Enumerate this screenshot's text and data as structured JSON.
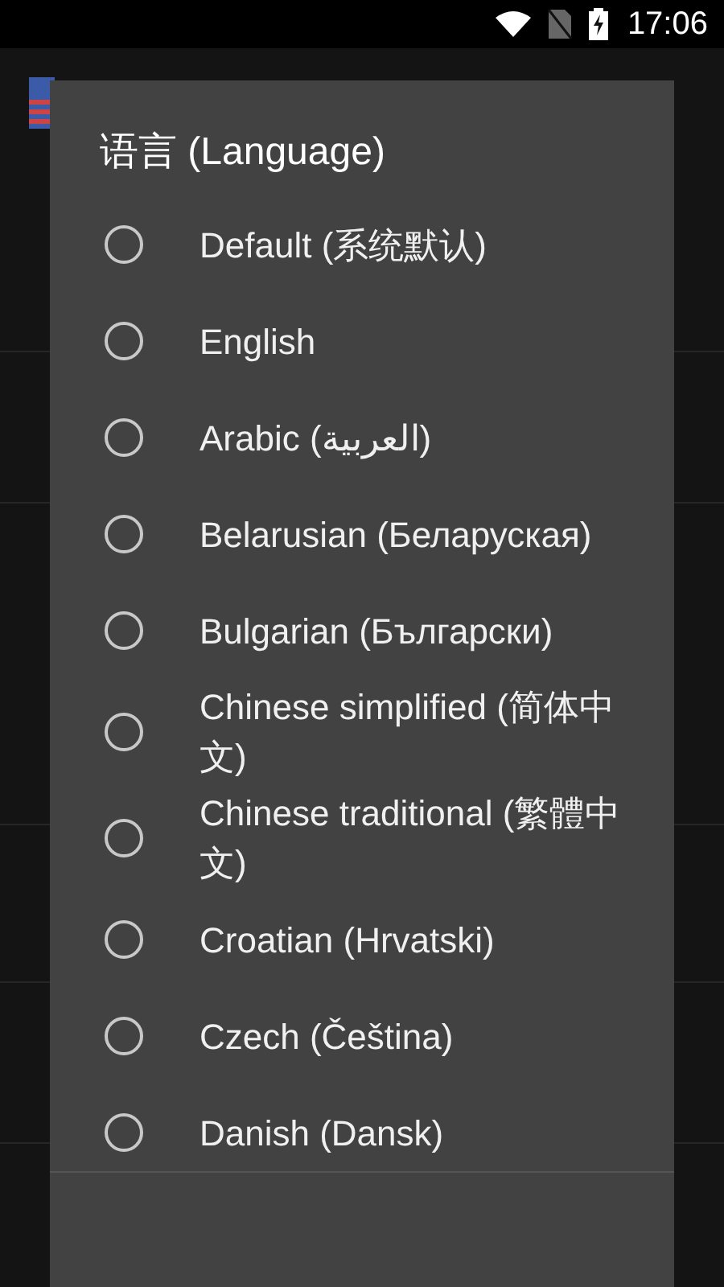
{
  "status_bar": {
    "time": "17:06"
  },
  "dialog": {
    "title": "语言 (Language)",
    "options": [
      {
        "label": "Default (系统默认)",
        "selected": false
      },
      {
        "label": "English",
        "selected": false
      },
      {
        "label": "Arabic (العربية)",
        "selected": false
      },
      {
        "label": "Belarusian (Беларуская)",
        "selected": false
      },
      {
        "label": "Bulgarian (Български)",
        "selected": false
      },
      {
        "label": "Chinese simplified (简体中文)",
        "selected": false
      },
      {
        "label": "Chinese traditional (繁體中文)",
        "selected": false
      },
      {
        "label": "Croatian (Hrvatski)",
        "selected": false
      },
      {
        "label": "Czech (Čeština)",
        "selected": false
      },
      {
        "label": "Danish (Dansk)",
        "selected": false
      }
    ]
  }
}
